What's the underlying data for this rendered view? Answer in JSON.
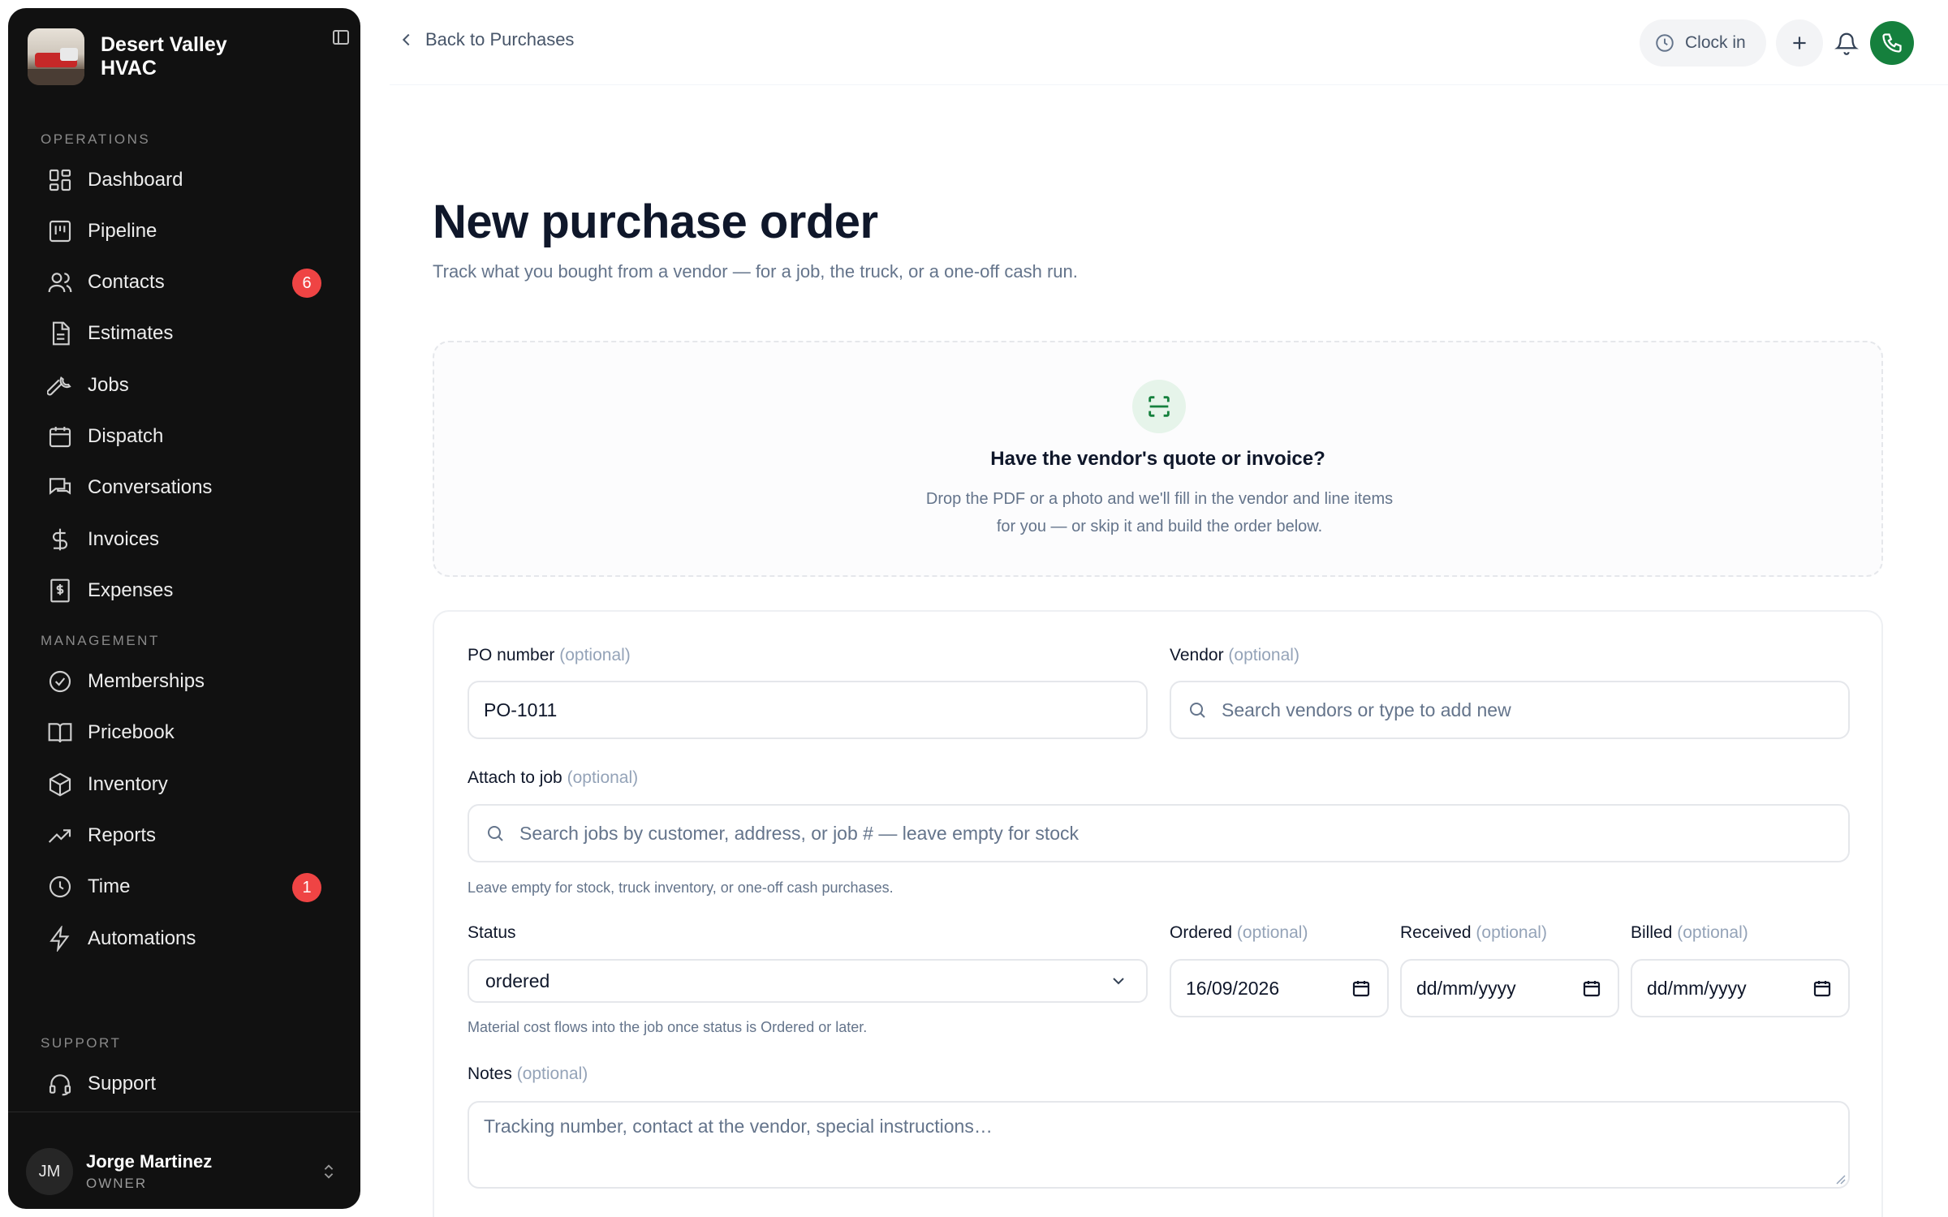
{
  "sidebar": {
    "brand": "Desert Valley HVAC",
    "sections": {
      "operations": "OPERATIONS",
      "management": "MANAGEMENT",
      "support": "SUPPORT"
    },
    "items": [
      {
        "label": "Dashboard",
        "icon": "dashboard-icon"
      },
      {
        "label": "Pipeline",
        "icon": "pipeline-icon"
      },
      {
        "label": "Contacts",
        "icon": "users-icon",
        "badge": "6"
      },
      {
        "label": "Estimates",
        "icon": "document-icon"
      },
      {
        "label": "Jobs",
        "icon": "wrench-icon"
      },
      {
        "label": "Dispatch",
        "icon": "calendar-icon"
      },
      {
        "label": "Conversations",
        "icon": "chat-icon"
      },
      {
        "label": "Invoices",
        "icon": "dollar-icon"
      },
      {
        "label": "Expenses",
        "icon": "receipt-icon"
      },
      {
        "label": "Memberships",
        "icon": "badge-check-icon"
      },
      {
        "label": "Pricebook",
        "icon": "book-icon"
      },
      {
        "label": "Inventory",
        "icon": "box-icon"
      },
      {
        "label": "Reports",
        "icon": "trending-icon"
      },
      {
        "label": "Time",
        "icon": "clock-icon",
        "badge": "1"
      },
      {
        "label": "Automations",
        "icon": "bolt-icon"
      },
      {
        "label": "Support",
        "icon": "headset-icon"
      }
    ],
    "user": {
      "initials": "JM",
      "name": "Jorge Martinez",
      "role": "OWNER"
    }
  },
  "topbar": {
    "back_label": "Back to Purchases",
    "clock_label": "Clock in"
  },
  "page": {
    "title": "New purchase order",
    "subtitle": "Track what you bought from a vendor — for a job, the truck, or a one-off cash run."
  },
  "dropzone": {
    "title": "Have the vendor's quote or invoice?",
    "text": "Drop the PDF or a photo and we'll fill in the vendor and line items for you — or skip it and build the order below."
  },
  "form": {
    "optional": "(optional)",
    "po_number": {
      "label": "PO number",
      "value": "PO-1011"
    },
    "vendor": {
      "label": "Vendor",
      "placeholder": "Search vendors or type to add new"
    },
    "job": {
      "label": "Attach to job",
      "placeholder": "Search jobs by customer, address, or job # — leave empty for stock",
      "hint": "Leave empty for stock, truck inventory, or one-off cash purchases."
    },
    "status": {
      "label": "Status",
      "value": "ordered",
      "hint": "Material cost flows into the job once status is Ordered or later."
    },
    "ordered": {
      "label": "Ordered",
      "value": "16/09/2026"
    },
    "received": {
      "label": "Received",
      "placeholder": "dd/mm/yyyy"
    },
    "billed": {
      "label": "Billed",
      "placeholder": "dd/mm/yyyy"
    },
    "notes": {
      "label": "Notes",
      "placeholder": "Tracking number, contact at the vendor, special instructions…"
    }
  },
  "colors": {
    "sidebar_bg": "#111111",
    "accent_green": "#15803d",
    "badge_red": "#ef4444"
  }
}
